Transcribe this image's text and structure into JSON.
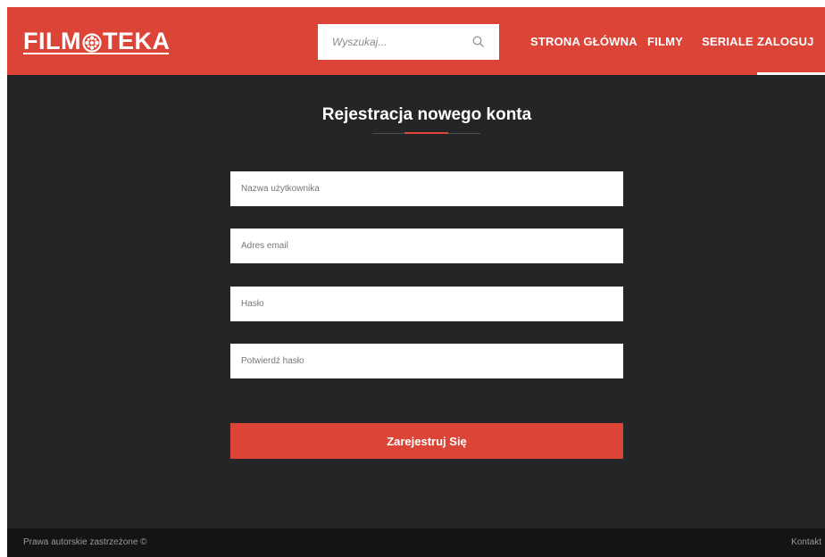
{
  "header": {
    "logo": {
      "left_text": "FILM",
      "right_text": "TEKA",
      "icon": "film-reel-icon"
    },
    "search": {
      "placeholder": "Wyszukaj...",
      "icon": "search-icon"
    },
    "nav": {
      "home": "STRONA GŁÓWNA",
      "films": "FILMY",
      "series": "SERIALE",
      "login": "ZALOGUJ"
    }
  },
  "form": {
    "title": "Rejestracja nowego konta",
    "username_placeholder": "Nazwa użytkownika",
    "email_placeholder": "Adres email",
    "password_placeholder": "Hasło",
    "confirm_password_placeholder": "Potwierdź hasło",
    "submit_label": "Zarejestruj Się"
  },
  "footer": {
    "copyright": "Prawa autorskie zastrzeżone ©",
    "contact": "Kontakt"
  },
  "colors": {
    "accent": "#db4437",
    "background": "#232526",
    "footer": "#141414",
    "text": "#ffffff"
  }
}
